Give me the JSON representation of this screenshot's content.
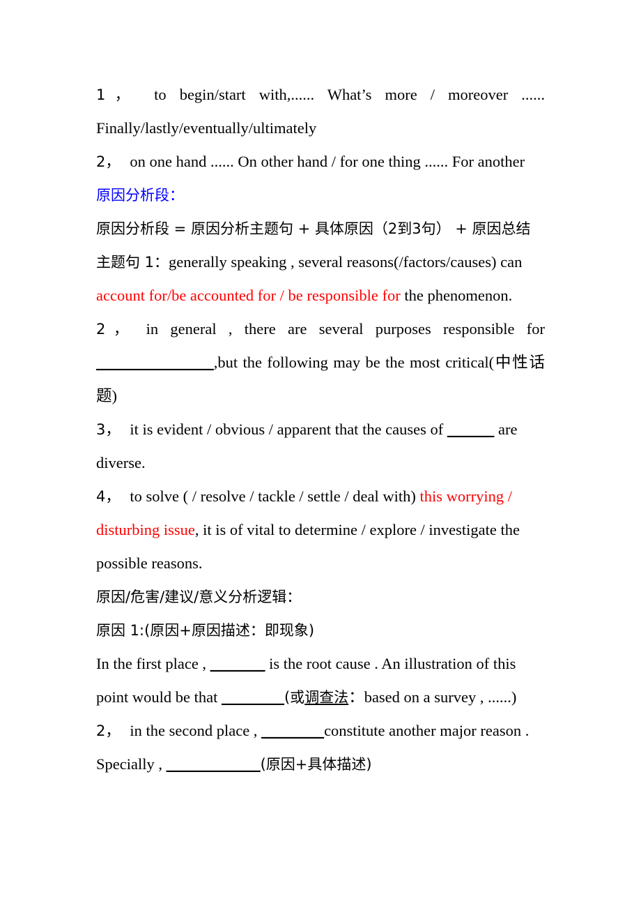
{
  "document": {
    "title": "原因分析段 写作模板",
    "colors": {
      "text": "#000000",
      "heading_blue": "#0000ff",
      "emphasis_red": "#ff0000",
      "background": "#ffffff"
    },
    "blocks": [
      {
        "id": "para-1",
        "kind": "justified",
        "runs": [
          {
            "text": "1，",
            "color": "#000000"
          },
          {
            "text": "to begin/start with,...... What’s more / moreover ...... Finally/lastly/eventually/ultimately",
            "color": "#000000"
          }
        ]
      },
      {
        "id": "para-2",
        "kind": "plain",
        "runs": [
          {
            "text": "2，",
            "color": "#000000"
          },
          {
            "text": "on one hand ...... On other hand / for one thing ...... For another",
            "color": "#000000"
          }
        ]
      },
      {
        "id": "heading-cause-analysis",
        "kind": "heading",
        "runs": [
          {
            "text": "原因分析段：",
            "color": "#0000ff"
          }
        ]
      },
      {
        "id": "formula-line",
        "kind": "justified",
        "runs": [
          {
            "text": "原因分析段 = 原因分析主题句 + 具体原因（2到3句） + 原因总结",
            "color": "#000000"
          }
        ]
      },
      {
        "id": "topic-sentence-1",
        "kind": "plain",
        "runs": [
          {
            "text": "主题句 1：",
            "color": "#000000"
          },
          {
            "text": "generally speaking , several reasons(/factors/causes) can ",
            "color": "#000000"
          },
          {
            "text": "account for/be accounted for / be responsible for",
            "color": "#ff0000"
          },
          {
            "text": " the phenomenon.",
            "color": "#000000"
          }
        ]
      },
      {
        "id": "topic-sentence-2",
        "kind": "justified",
        "runs": [
          {
            "text": "2，",
            "color": "#000000"
          },
          {
            "text": "in general , there are several purposes responsible for ",
            "color": "#000000"
          },
          {
            "text": "_______________",
            "color": "#000000",
            "blank": true
          },
          {
            "text": ",but the following may be the most critical(中性话题)",
            "color": "#000000"
          }
        ]
      },
      {
        "id": "topic-sentence-3",
        "kind": "plain",
        "runs": [
          {
            "text": "3，",
            "color": "#000000"
          },
          {
            "text": "it is evident / obvious / apparent that the causes of ",
            "color": "#000000"
          },
          {
            "text": "______",
            "color": "#000000",
            "blank": true
          },
          {
            "text": " are diverse.",
            "color": "#000000"
          }
        ]
      },
      {
        "id": "topic-sentence-4",
        "kind": "plain",
        "runs": [
          {
            "text": "4，",
            "color": "#000000"
          },
          {
            "text": "to solve ( / resolve / tackle / settle / deal with) ",
            "color": "#000000"
          },
          {
            "text": "this worrying / disturbing issue",
            "color": "#ff0000"
          },
          {
            "text": ", it is of vital to determine / explore / investigate the possible reasons.",
            "color": "#000000"
          }
        ]
      },
      {
        "id": "logic-heading",
        "kind": "plain",
        "runs": [
          {
            "text": "原因/危害/建议/意义分析逻辑：",
            "color": "#000000"
          }
        ]
      },
      {
        "id": "cause-1-label",
        "kind": "plain",
        "runs": [
          {
            "text": "原因 1:(原因+原因描述：即现象)",
            "color": "#000000"
          }
        ]
      },
      {
        "id": "cause-1-body",
        "kind": "plain",
        "runs": [
          {
            "text": "In the first place , ",
            "color": "#000000"
          },
          {
            "text": "_______",
            "color": "#000000",
            "blank": true
          },
          {
            "text": " is the root cause . An illustration of this point would be that ",
            "color": "#000000"
          },
          {
            "text": "________",
            "color": "#000000",
            "blank": true
          },
          {
            "text": "(或",
            "color": "#000000"
          },
          {
            "text": "调查法",
            "color": "#000000",
            "underline": true
          },
          {
            "text": "：based on a survey , ......)",
            "color": "#000000"
          }
        ]
      },
      {
        "id": "cause-2-body",
        "kind": "plain",
        "runs": [
          {
            "text": "2，",
            "color": "#000000"
          },
          {
            "text": "in the second place , ",
            "color": "#000000"
          },
          {
            "text": "________",
            "color": "#000000",
            "blank": true
          },
          {
            "text": "constitute another major reason .",
            "color": "#000000"
          }
        ]
      },
      {
        "id": "cause-2-detail",
        "kind": "plain",
        "runs": [
          {
            "text": "Specially , ",
            "color": "#000000"
          },
          {
            "text": "____________",
            "color": "#000000",
            "blank": true
          },
          {
            "text": "(原因+具体描述)",
            "color": "#000000"
          }
        ]
      }
    ]
  }
}
